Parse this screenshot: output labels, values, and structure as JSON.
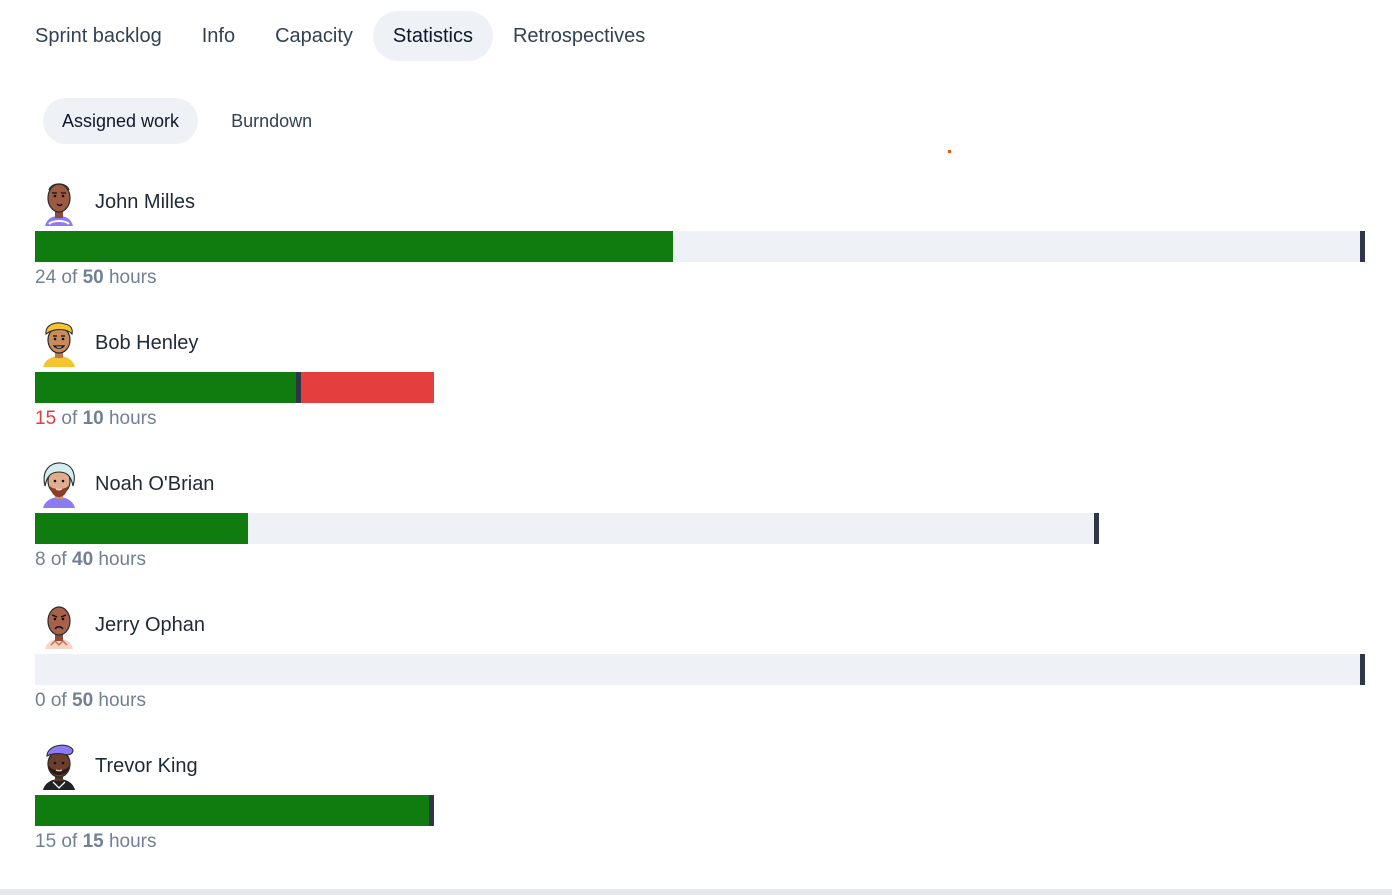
{
  "tabs": [
    {
      "label": "Sprint backlog",
      "active": false
    },
    {
      "label": "Info",
      "active": false
    },
    {
      "label": "Capacity",
      "active": false
    },
    {
      "label": "Statistics",
      "active": true
    },
    {
      "label": "Retrospectives",
      "active": false
    }
  ],
  "subtabs": [
    {
      "label": "Assigned work",
      "active": true
    },
    {
      "label": "Burndown",
      "active": false
    }
  ],
  "colors": {
    "assigned": "#107c10",
    "overallocated": "#e53e3e",
    "remaining": "#eef2f6",
    "marker": "#2d3748"
  },
  "of_word": "of",
  "unit_word": "hours",
  "people": [
    {
      "name": "John Milles",
      "assigned": 24,
      "capacity": 50,
      "avatar": "avatar-john-milles"
    },
    {
      "name": "Bob Henley",
      "assigned": 15,
      "capacity": 10,
      "avatar": "avatar-bob-henley"
    },
    {
      "name": "Noah O'Brian",
      "assigned": 8,
      "capacity": 40,
      "avatar": "avatar-noah-obrian"
    },
    {
      "name": "Jerry Ophan",
      "assigned": 0,
      "capacity": 50,
      "avatar": "avatar-jerry-ophan"
    },
    {
      "name": "Trevor King",
      "assigned": 15,
      "capacity": 15,
      "avatar": "avatar-trevor-king"
    }
  ]
}
